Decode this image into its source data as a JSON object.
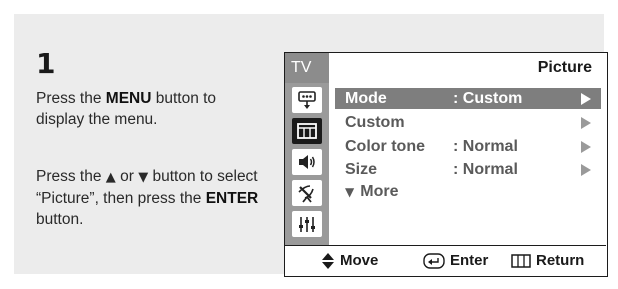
{
  "step": {
    "number": "1"
  },
  "instructions": {
    "p1_before": "Press the ",
    "p1_bold": "MENU",
    "p1_after": " button to display the menu.",
    "p2_a": "Press the ",
    "p2_up": "▲",
    "p2_or": " or ",
    "p2_down": "▼",
    "p2_b": " button to select “Picture”, then press the ",
    "p2_bold": "ENTER",
    "p2_c": " button."
  },
  "osd": {
    "tab_label": "TV",
    "title": "Picture",
    "sidebar_icons": [
      "input-icon",
      "picture-icon",
      "sound-icon",
      "channel-antenna-icon",
      "setup-icon"
    ],
    "rows": [
      {
        "label": "Mode",
        "value": ": Custom",
        "selected": true
      },
      {
        "label": "Custom",
        "value": "",
        "selected": false
      },
      {
        "label": "Color tone",
        "value": ": Normal",
        "selected": false
      },
      {
        "label": "Size",
        "value": ": Normal",
        "selected": false
      }
    ],
    "more_label": "More",
    "footer": {
      "move": "Move",
      "enter": "Enter",
      "return": "Return"
    }
  },
  "colors": {
    "panel_bg": "#ececec",
    "osd_sidebar": "#9a9a9a",
    "osd_selected_row": "#7e7e7e",
    "osd_tab": "#8c8c8c"
  }
}
